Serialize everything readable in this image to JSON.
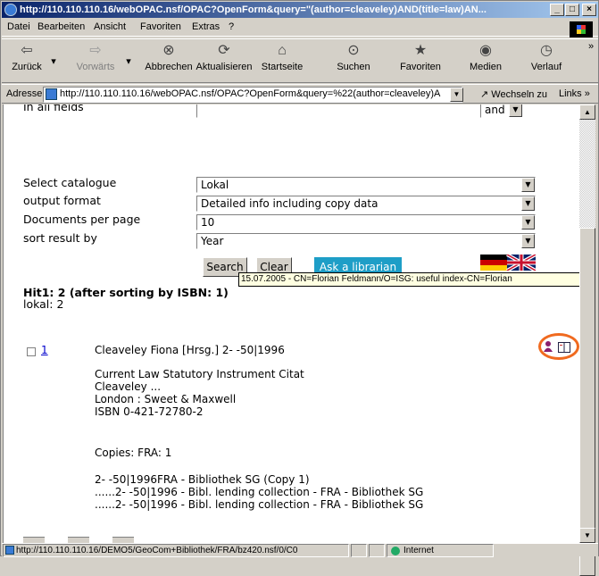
{
  "window": {
    "title": "http://110.110.110.16/webOPAC.nsf/OPAC?OpenForm&query=\"(author=cleaveley)AND(title=law)AN..."
  },
  "menu": [
    "Datei",
    "Bearbeiten",
    "Ansicht",
    "Favoriten",
    "Extras",
    "?"
  ],
  "toolbar": {
    "back": "Zurück",
    "forward": "Vorwärts",
    "stop": "Abbrechen",
    "refresh": "Aktualisieren",
    "home": "Startseite",
    "search": "Suchen",
    "favorites": "Favoriten",
    "media": "Medien",
    "history": "Verlauf"
  },
  "address": {
    "label": "Adresse",
    "url": "http://110.110.110.16/webOPAC.nsf/OPAC?OpenForm&query=%22(author=cleaveley)A",
    "go": "Wechseln zu",
    "links": "Links"
  },
  "form": {
    "cutoff_label": "In all fields",
    "cutoff_op": "and",
    "fields": [
      {
        "label": "Select catalogue",
        "value": "Lokal"
      },
      {
        "label": "output format",
        "value": "Detailed info including copy data"
      },
      {
        "label": "Documents per page",
        "value": "10"
      },
      {
        "label": "sort result by",
        "value": "Year"
      }
    ],
    "search_button": "Search",
    "clear_button": "Clear",
    "ask_button": "Ask a librarian"
  },
  "results": {
    "hit_line": "Hit1: 2 (after sorting by ISBN: 1)",
    "lokal_line": "lokal: 2",
    "item_number": "1",
    "heading": "Cleaveley Fiona [Hrsg.] 2- -50|1996",
    "title_line": "Current Law Statutory Instrument Citat",
    "author_line": "Cleaveley ...",
    "publisher_line": "London : Sweet & Maxwell",
    "isbn_line": "ISBN 0-421-72780-2",
    "copies_line": "Copies: FRA: 1",
    "copy_lines": [
      "2- -50|1996FRA - Bibliothek SG (Copy 1)",
      "......2- -50|1996 - Bibl. lending collection - FRA - Bibliothek SG",
      "......2- -50|1996 - Bibl. lending collection - FRA - Bibliothek SG"
    ],
    "tooltip": "15.07.2005 - CN=Florian Feldmann/O=ISG: useful index-CN=Florian"
  },
  "status": {
    "url": "http://110.110.110.16/DEMO5/GeoCom+Bibliothek/FRA/bz420.nsf/0/C0",
    "zone": "Internet"
  },
  "colors": {
    "ask_button": "#1e9ec7",
    "highlight_ring": "#f06a1f",
    "link": "#0000cc"
  }
}
